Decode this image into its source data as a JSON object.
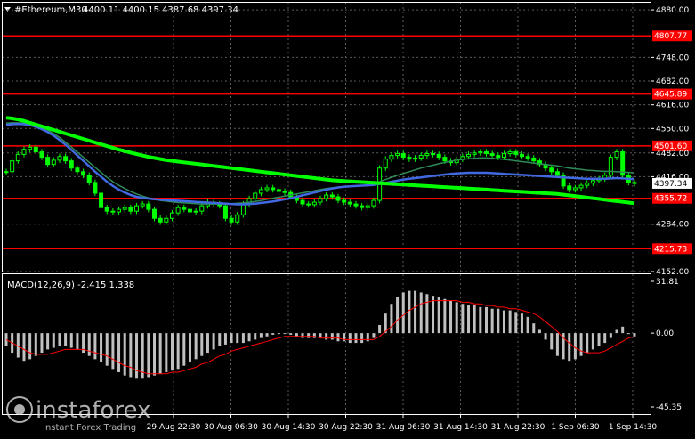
{
  "header": {
    "symbol": "#Ethereum,M30",
    "ohlc": "4400.11 4400.15 4387.68 4397.34"
  },
  "macd_label": "MACD(12,26,9) -2.415 1.338",
  "watermark": {
    "brand": "instaforex",
    "tagline": "Instant Forex Trading"
  },
  "colors": {
    "background": "#000000",
    "candle": "#00ff00",
    "level_line": "#ff0000",
    "ma_fast": "#4169e1",
    "ma_mid": "#2e8b57",
    "ma_slow": "#00ff00",
    "macd_hist": "#c0c0c0",
    "macd_signal": "#ff0000"
  },
  "chart_data": [
    {
      "type": "candlestick",
      "name": "price",
      "ylim": [
        4152,
        4900
      ],
      "y_ticks": [
        "4880.00",
        "4748.00",
        "4682.00",
        "4616.00",
        "4550.00",
        "4482.00",
        "4416.00",
        "4284.00",
        "4152.00"
      ],
      "x_ticks": [
        "29 Aug 22:30",
        "30 Aug 06:30",
        "30 Aug 14:30",
        "30 Aug 22:30",
        "31 Aug 06:30",
        "31 Aug 14:30",
        "31 Aug 22:30",
        "1 Sep 06:30",
        "1 Sep 14:30"
      ],
      "levels": [
        {
          "value": 4807.77,
          "label": "4807.77"
        },
        {
          "value": 4645.89,
          "label": "4645.89"
        },
        {
          "value": 4501.6,
          "label": "4501.60"
        },
        {
          "value": 4355.72,
          "label": "4355.72"
        },
        {
          "value": 4215.73,
          "label": "4215.73"
        }
      ],
      "current_price": {
        "value": 4397.34,
        "label": "4397.34"
      },
      "close_series": [
        4430,
        4460,
        4478,
        4492,
        4498,
        4485,
        4470,
        4450,
        4462,
        4472,
        4460,
        4440,
        4430,
        4420,
        4400,
        4370,
        4330,
        4320,
        4318,
        4325,
        4330,
        4320,
        4335,
        4340,
        4325,
        4300,
        4290,
        4300,
        4315,
        4330,
        4325,
        4318,
        4320,
        4335,
        4345,
        4340,
        4335,
        4300,
        4290,
        4310,
        4340,
        4355,
        4370,
        4380,
        4385,
        4380,
        4375,
        4372,
        4360,
        4350,
        4340,
        4338,
        4345,
        4355,
        4365,
        4360,
        4350,
        4345,
        4340,
        4335,
        4330,
        4335,
        4350,
        4440,
        4465,
        4475,
        4480,
        4470,
        4465,
        4468,
        4475,
        4480,
        4478,
        4470,
        4460,
        4455,
        4465,
        4472,
        4478,
        4482,
        4485,
        4480,
        4475,
        4470,
        4480,
        4485,
        4478,
        4472,
        4468,
        4460,
        4450,
        4440,
        4430,
        4420,
        4390,
        4380,
        4385,
        4392,
        4398,
        4405,
        4410,
        4420,
        4470,
        4485,
        4420,
        4400,
        4397
      ],
      "ma_slow_series": [
        4580,
        4578,
        4575,
        4571,
        4566,
        4561,
        4556,
        4551,
        4546,
        4541,
        4536,
        4531,
        4526,
        4521,
        4516,
        4511,
        4506,
        4501,
        4496,
        4491,
        4487,
        4483,
        4479,
        4475,
        4471,
        4468,
        4465,
        4462,
        4460,
        4458,
        4456,
        4454,
        4452,
        4450,
        4448,
        4446,
        4444,
        4442,
        4440,
        4438,
        4436,
        4434,
        4432,
        4430,
        4428,
        4426,
        4424,
        4422,
        4420,
        4418,
        4416,
        4414,
        4412,
        4410,
        4408,
        4406,
        4405,
        4404,
        4403,
        4402,
        4401,
        4400,
        4399,
        4398,
        4397,
        4396,
        4395,
        4394,
        4393,
        4392,
        4391,
        4390,
        4389,
        4388,
        4387,
        4386,
        4385,
        4384,
        4383,
        4382,
        4381,
        4380,
        4379,
        4378,
        4377,
        4376,
        4375,
        4374,
        4373,
        4372,
        4371,
        4370,
        4369,
        4368,
        4366,
        4364,
        4362,
        4360,
        4358,
        4356,
        4354,
        4352,
        4350,
        4348,
        4346,
        4344,
        4342
      ],
      "ma_fast_series": [
        4560,
        4562,
        4563,
        4562,
        4560,
        4555,
        4548,
        4540,
        4530,
        4518,
        4505,
        4490,
        4475,
        4460,
        4445,
        4430,
        4416,
        4402,
        4390,
        4380,
        4372,
        4365,
        4360,
        4357,
        4355,
        4353,
        4352,
        4351,
        4350,
        4349,
        4348,
        4347,
        4346,
        4345,
        4344,
        4343,
        4342,
        4341,
        4340,
        4339,
        4339,
        4340,
        4341,
        4343,
        4345,
        4347,
        4350,
        4353,
        4356,
        4360,
        4364,
        4368,
        4372,
        4376,
        4380,
        4383,
        4386,
        4388,
        4389,
        4390,
        4391,
        4392,
        4393,
        4396,
        4399,
        4402,
        4405,
        4408,
        4410,
        4412,
        4414,
        4416,
        4418,
        4420,
        4422,
        4424,
        4425,
        4426,
        4427,
        4427,
        4427,
        4427,
        4426,
        4425,
        4424,
        4423,
        4422,
        4421,
        4420,
        4419,
        4418,
        4417,
        4416,
        4415,
        4414,
        4413,
        4412,
        4411,
        4410,
        4410,
        4410,
        4410,
        4411,
        4412,
        4411,
        4410,
        4409
      ],
      "ma_mid_series": [
        4565,
        4566,
        4566,
        4565,
        4562,
        4558,
        4552,
        4545,
        4536,
        4525,
        4512,
        4498,
        4484,
        4470,
        4456,
        4442,
        4428,
        4414,
        4402,
        4392,
        4383,
        4375,
        4368,
        4362,
        4357,
        4353,
        4350,
        4348,
        4346,
        4344,
        4343,
        4342,
        4341,
        4340,
        4340,
        4340,
        4340,
        4340,
        4341,
        4342,
        4343,
        4345,
        4347,
        4350,
        4353,
        4356,
        4359,
        4362,
        4365,
        4368,
        4371,
        4374,
        4377,
        4380,
        4383,
        4385,
        4387,
        4388,
        4389,
        4390,
        4391,
        4393,
        4396,
        4402,
        4408,
        4414,
        4420,
        4425,
        4430,
        4435,
        4440,
        4444,
        4448,
        4452,
        4456,
        4459,
        4462,
        4464,
        4466,
        4467,
        4468,
        4468,
        4467,
        4466,
        4464,
        4462,
        4460,
        4458,
        4456,
        4454,
        4452,
        4450,
        4448,
        4446,
        4443,
        4440,
        4438,
        4436,
        4434,
        4433,
        4432,
        4431,
        4431,
        4430,
        4429,
        4428,
        4427
      ]
    },
    {
      "type": "bar",
      "name": "MACD(12,26,9)",
      "ylim": [
        -45.35,
        31.81
      ],
      "y_ticks": [
        "31.81",
        "0.00",
        "-45.35"
      ],
      "histogram": [
        -8,
        -12,
        -15,
        -17,
        -16,
        -14,
        -12,
        -10,
        -9,
        -8,
        -8,
        -9,
        -10,
        -12,
        -14,
        -16,
        -18,
        -20,
        -22,
        -24,
        -26,
        -27,
        -28,
        -28,
        -27,
        -26,
        -25,
        -24,
        -23,
        -22,
        -20,
        -18,
        -16,
        -14,
        -12,
        -10,
        -8,
        -7,
        -6,
        -6,
        -6,
        -5,
        -4,
        -3,
        -2,
        -1,
        0,
        0,
        -1,
        -2,
        -3,
        -3,
        -3,
        -3,
        -4,
        -4,
        -5,
        -5,
        -6,
        -6,
        -6,
        -5,
        -3,
        5,
        12,
        18,
        22,
        25,
        26,
        26,
        25,
        24,
        23,
        22,
        21,
        20,
        19,
        18,
        17,
        17,
        16,
        16,
        15,
        15,
        14,
        14,
        13,
        12,
        10,
        6,
        2,
        -4,
        -10,
        -14,
        -16,
        -17,
        -16,
        -14,
        -12,
        -10,
        -8,
        -6,
        -3,
        2,
        4,
        0,
        -2
      ],
      "signal": [
        -4,
        -6,
        -8,
        -10,
        -12,
        -13,
        -13,
        -13,
        -12,
        -11,
        -10,
        -10,
        -10,
        -10,
        -11,
        -12,
        -13,
        -14,
        -16,
        -18,
        -20,
        -21,
        -23,
        -24,
        -25,
        -25,
        -25,
        -25,
        -24,
        -24,
        -23,
        -22,
        -21,
        -19,
        -18,
        -16,
        -14,
        -13,
        -11,
        -10,
        -9,
        -8,
        -7,
        -6,
        -5,
        -4,
        -3,
        -2,
        -2,
        -2,
        -2,
        -2,
        -2,
        -3,
        -3,
        -3,
        -3,
        -4,
        -4,
        -4,
        -4,
        -4,
        -4,
        -2,
        1,
        4,
        8,
        11,
        14,
        16,
        18,
        19,
        20,
        20,
        20,
        20,
        20,
        19,
        19,
        18,
        18,
        17,
        17,
        16,
        16,
        15,
        15,
        14,
        13,
        12,
        10,
        7,
        4,
        1,
        -3,
        -6,
        -9,
        -11,
        -12,
        -12,
        -12,
        -11,
        -9,
        -7,
        -5,
        -3,
        -2
      ]
    }
  ]
}
